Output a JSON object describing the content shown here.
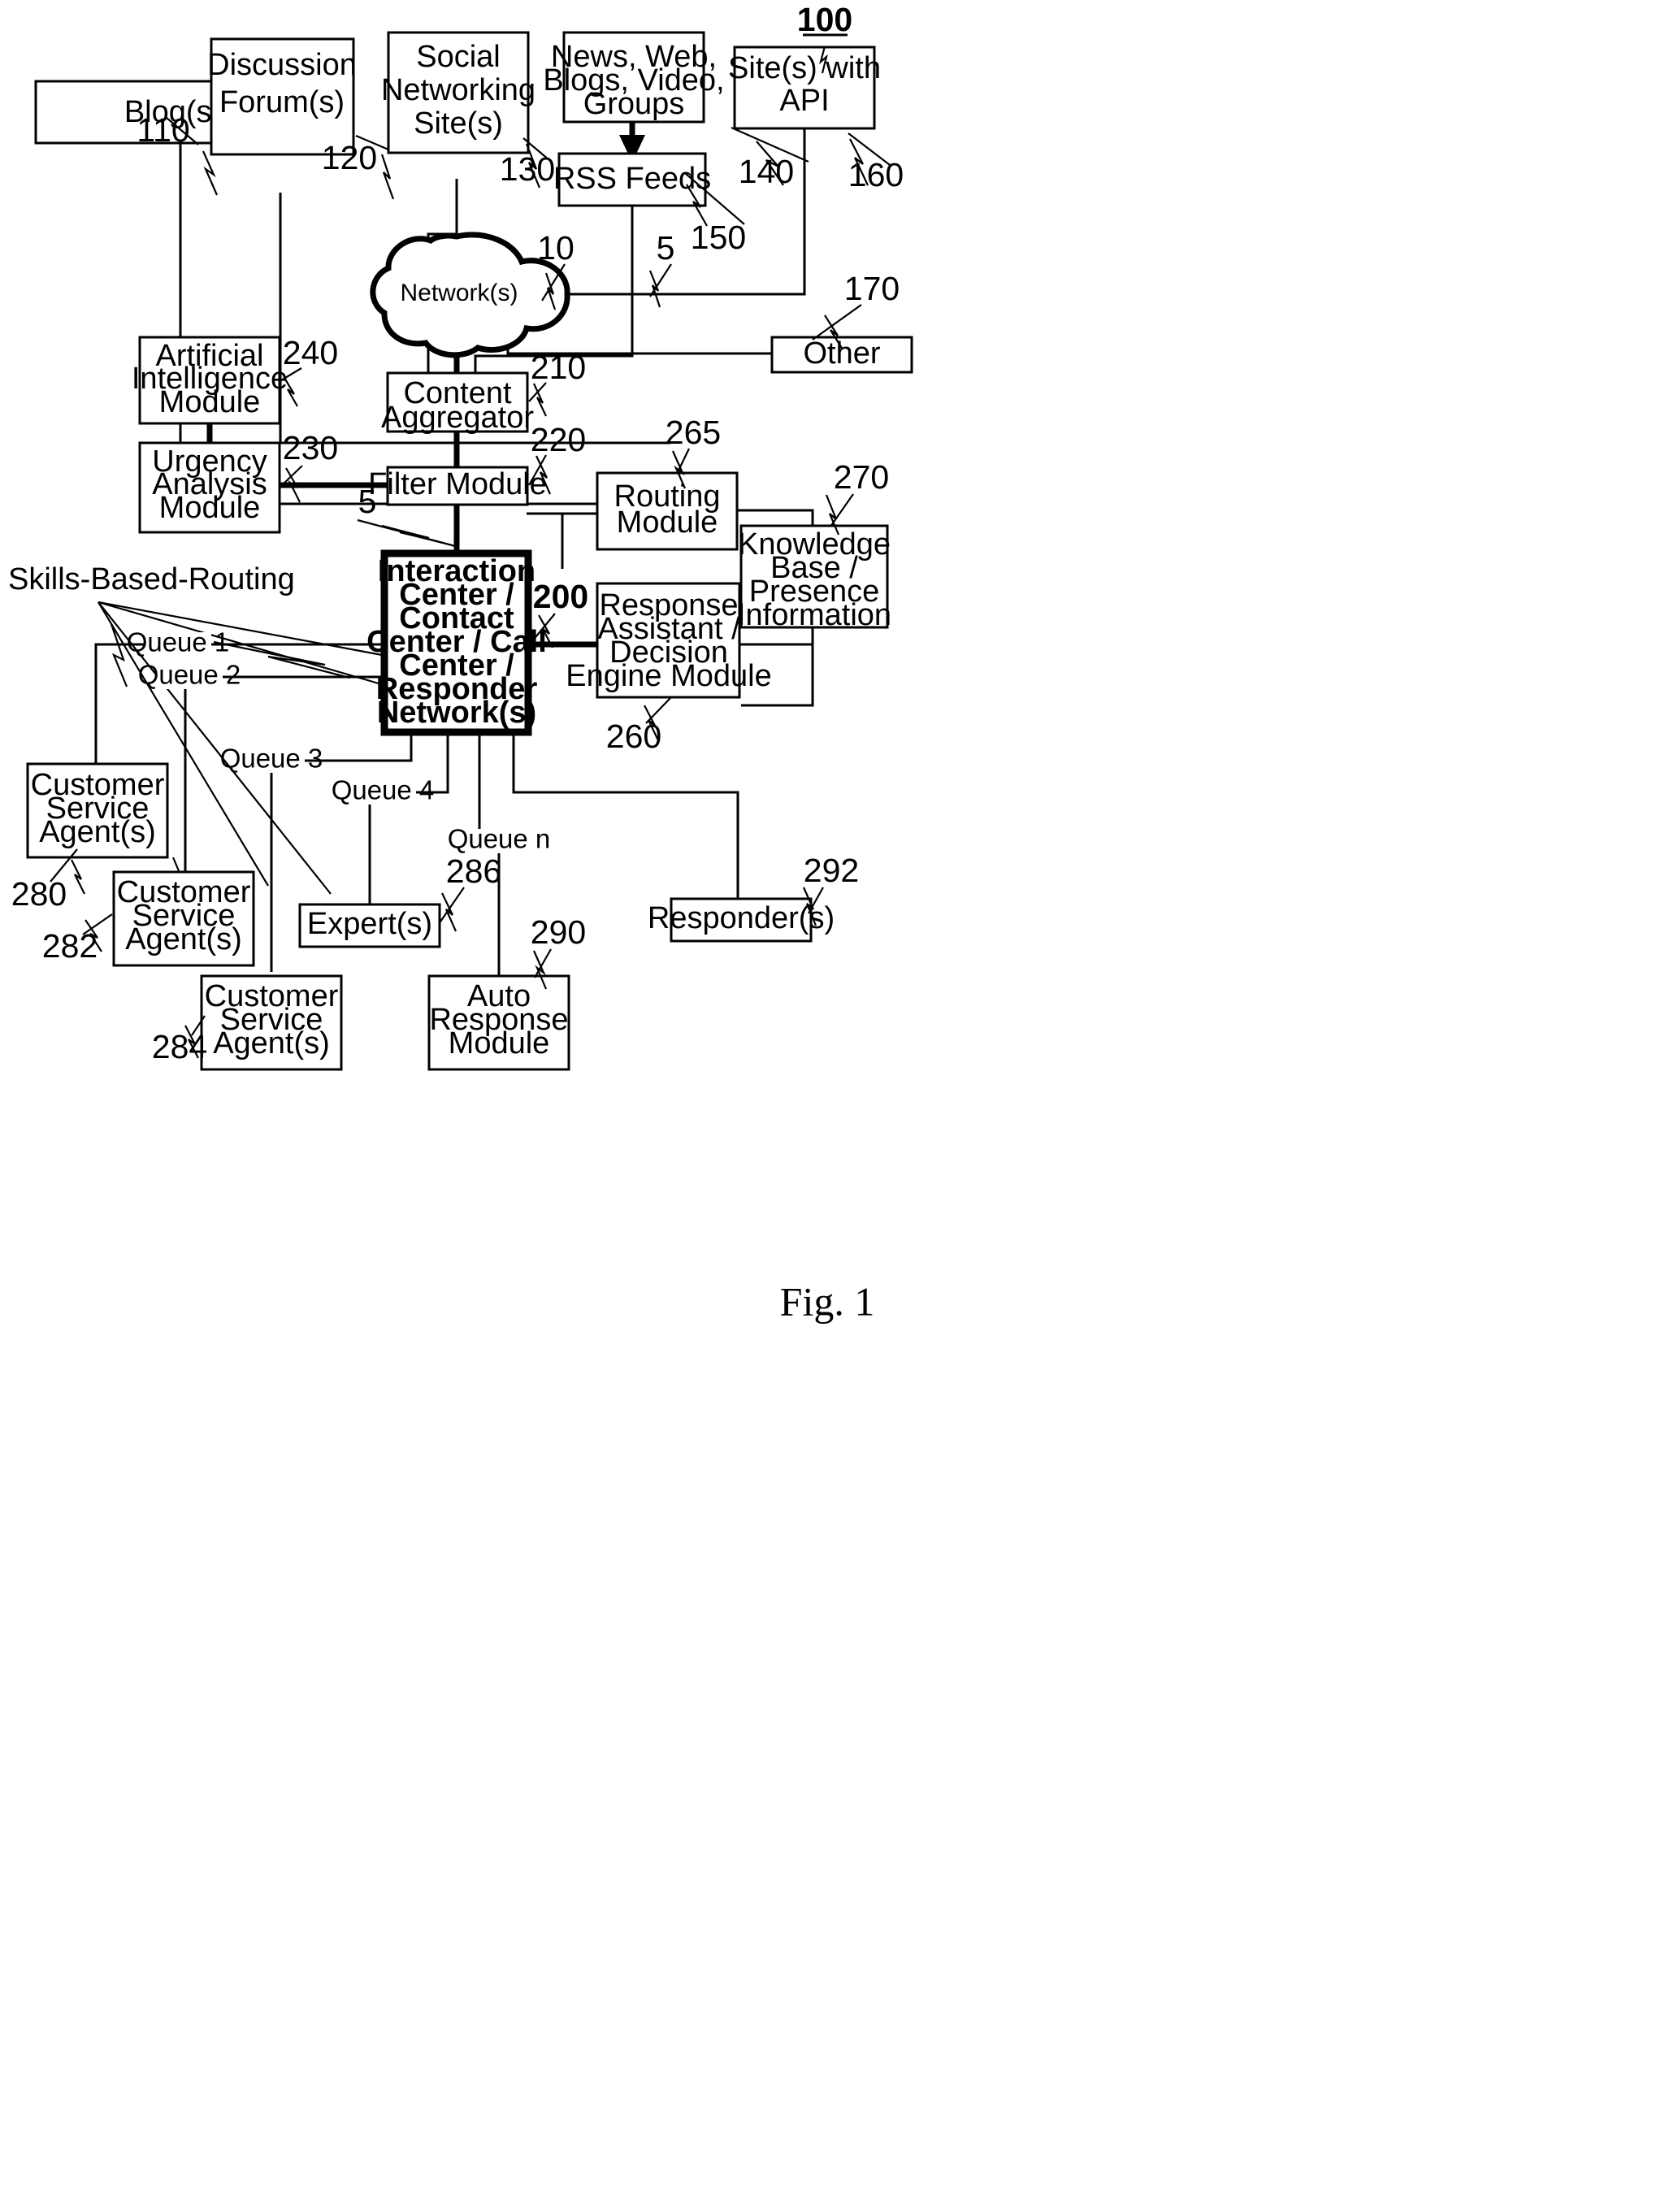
{
  "figure": {
    "caption": "Fig. 1",
    "system_ref": "100"
  },
  "nodes": [
    {
      "id": "blogs",
      "label": "Blog(s)",
      "ref": "110"
    },
    {
      "id": "forums",
      "label": "Discussion\nForum(s)",
      "ref": "120"
    },
    {
      "id": "social",
      "label": "Social\nNetworking\nSite(s)",
      "ref": "130"
    },
    {
      "id": "news",
      "label": "News, Web,\nBlogs, Video,\nGroups",
      "ref": "140"
    },
    {
      "id": "rss",
      "label": "RSS Feeds",
      "ref": "150"
    },
    {
      "id": "api",
      "label": "Site(s) with\nAPI",
      "ref": "160"
    },
    {
      "id": "other",
      "label": "Other",
      "ref": "170"
    },
    {
      "id": "network",
      "label": "Network(s)",
      "ref": "10"
    },
    {
      "id": "aggregator",
      "label": "Content\nAggregator",
      "ref": "210"
    },
    {
      "id": "filter",
      "label": "Filter Module",
      "ref": "220"
    },
    {
      "id": "urgency",
      "label": "Urgency\nAnalysis\nModule",
      "ref": "230"
    },
    {
      "id": "ai",
      "label": "Artificial\nIntelligence\nModule",
      "ref": "240"
    },
    {
      "id": "interaction",
      "label": "Interaction\nCenter /\nContact\nCenter / Call\nCenter /\nResponder\nNetwork(s)",
      "ref": "200"
    },
    {
      "id": "routing",
      "label": "Routing\nModule",
      "ref": "265"
    },
    {
      "id": "knowledge",
      "label": "Knowledge\nBase /\nPresence\nInformation",
      "ref": "270"
    },
    {
      "id": "response",
      "label": "Response\nAssistant /\nDecision\nEngine Module",
      "ref": "260"
    },
    {
      "id": "agent1",
      "label": "Customer\nService\nAgent(s)",
      "ref": "280"
    },
    {
      "id": "agent2",
      "label": "Customer\nService\nAgent(s)",
      "ref": "282"
    },
    {
      "id": "agent3",
      "label": "Customer\nService\nAgent(s)",
      "ref": "284"
    },
    {
      "id": "expert",
      "label": "Expert(s)",
      "ref": "286"
    },
    {
      "id": "auto",
      "label": "Auto\nResponse\nModule",
      "ref": "290"
    },
    {
      "id": "responder",
      "label": "Responder(s)",
      "ref": "292"
    }
  ],
  "labels": {
    "skills_based_routing": "Skills-Based-Routing",
    "queues": [
      "Queue 1",
      "Queue 2",
      "Queue 3",
      "Queue 4",
      "Queue n"
    ],
    "link_refs": [
      "5",
      "5",
      "10"
    ]
  },
  "box_lines": {
    "blogs": [
      "Blog(s)"
    ],
    "forums": [
      "Discussion",
      "Forum(s)"
    ],
    "social": [
      "Social",
      "Networking",
      "Site(s)"
    ],
    "news": [
      "News, Web,",
      "Blogs, Video,",
      "Groups"
    ],
    "rss": [
      "RSS Feeds"
    ],
    "api": [
      "Site(s) with",
      "API"
    ],
    "other": [
      "Other"
    ],
    "network": [
      "Network(s)"
    ],
    "aggregator": [
      "Content",
      "Aggregator"
    ],
    "filter": [
      "Filter Module"
    ],
    "urgency": [
      "Urgency",
      "Analysis",
      "Module"
    ],
    "ai": [
      "Artificial",
      "Intelligence",
      "Module"
    ],
    "interaction": [
      "Interaction",
      "Center /",
      "Contact",
      "Center / Call",
      "Center /",
      "Responder",
      "Network(s)"
    ],
    "routing": [
      "Routing",
      "Module"
    ],
    "knowledge": [
      "Knowledge",
      "Base /",
      "Presence",
      "Information"
    ],
    "response": [
      "Response",
      "Assistant /",
      "Decision",
      "Engine Module"
    ],
    "agent1": [
      "Customer",
      "Service",
      "Agent(s)"
    ],
    "agent2": [
      "Customer",
      "Service",
      "Agent(s)"
    ],
    "agent3": [
      "Customer",
      "Service",
      "Agent(s)"
    ],
    "expert": [
      "Expert(s)"
    ],
    "auto": [
      "Auto",
      "Response",
      "Module"
    ],
    "responder": [
      "Responder(s)"
    ]
  },
  "refs": {
    "r100": "100",
    "r110": "110",
    "r120": "120",
    "r130": "130",
    "r140": "140",
    "r150": "150",
    "r160": "160",
    "r170": "170",
    "r10": "10",
    "r5a": "5",
    "r5b": "5",
    "r210": "210",
    "r220": "220",
    "r230": "230",
    "r240": "240",
    "r200": "200",
    "r265": "265",
    "r270": "270",
    "r260": "260",
    "r280": "280",
    "r282": "282",
    "r284": "284",
    "r286": "286",
    "r290": "290",
    "r292": "292"
  },
  "colors": {
    "ink": "#000000",
    "paper": "#ffffff"
  }
}
